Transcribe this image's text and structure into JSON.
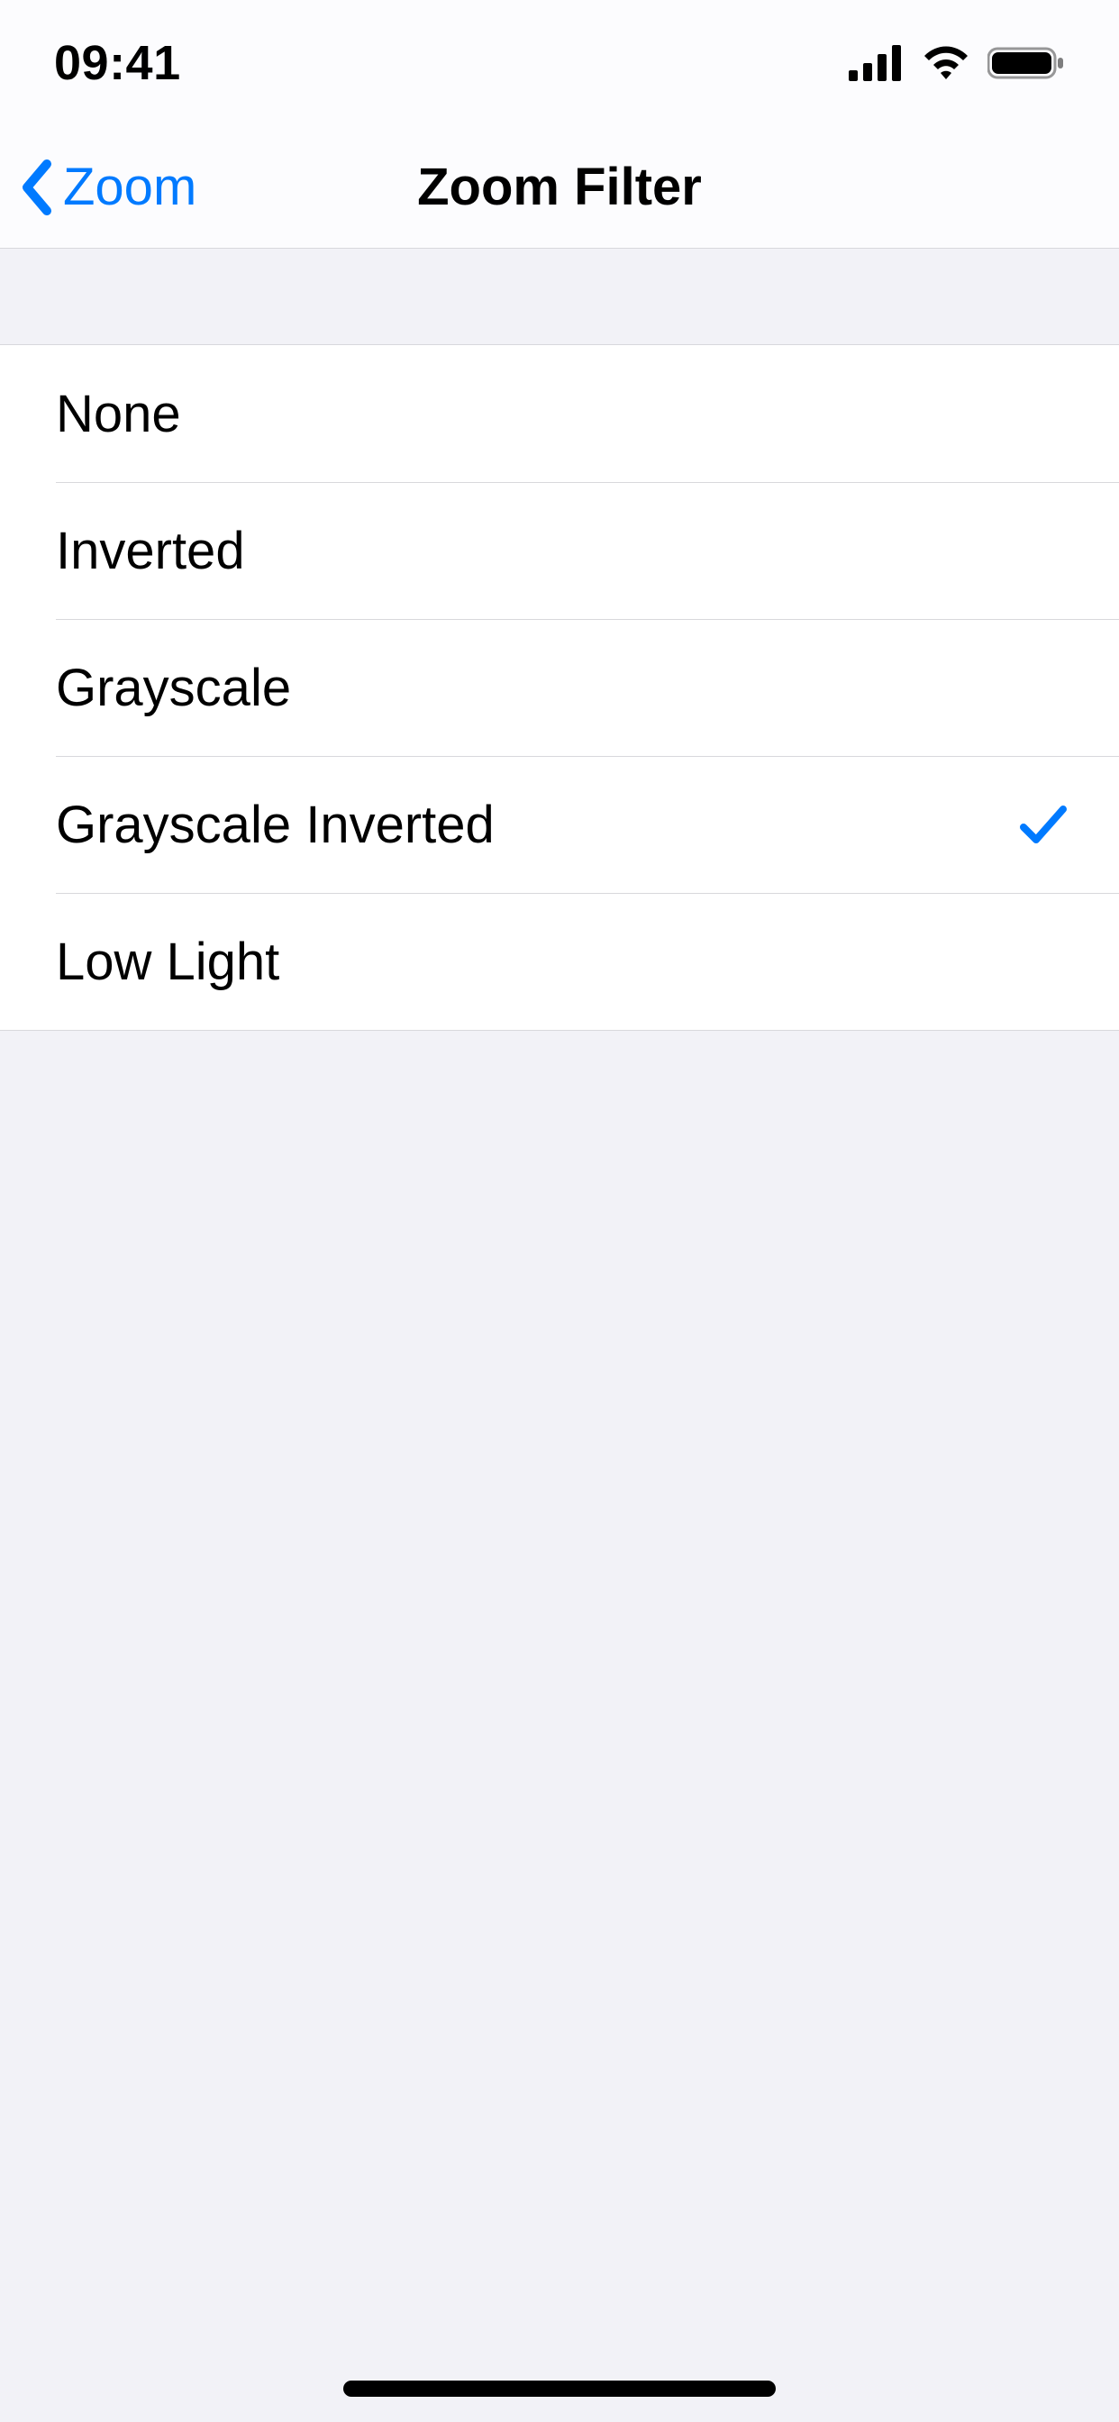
{
  "status": {
    "time": "09:41"
  },
  "nav": {
    "back_label": "Zoom",
    "title": "Zoom Filter"
  },
  "options": [
    {
      "label": "None",
      "selected": false
    },
    {
      "label": "Inverted",
      "selected": false
    },
    {
      "label": "Grayscale",
      "selected": false
    },
    {
      "label": "Grayscale Inverted",
      "selected": true
    },
    {
      "label": "Low Light",
      "selected": false
    }
  ]
}
